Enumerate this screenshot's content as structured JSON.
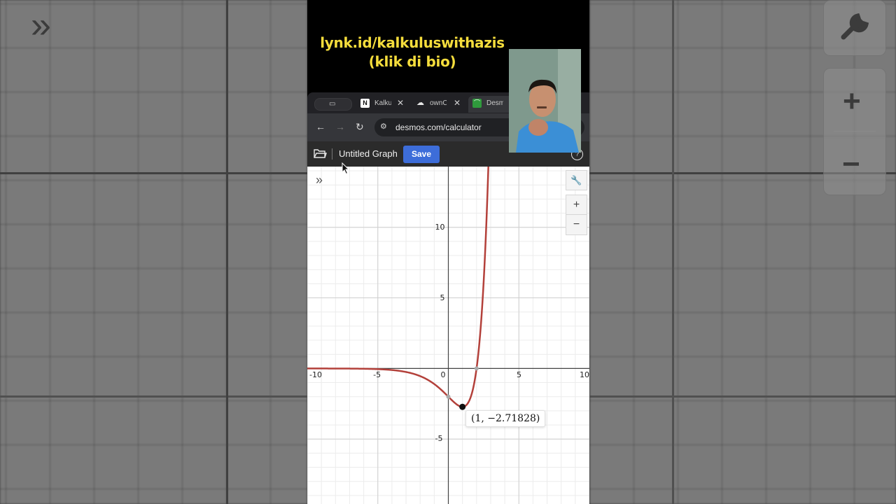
{
  "background": {
    "expand_glyph": "»",
    "wrench_glyph": "🔧",
    "plus_glyph": "+",
    "minus_glyph": "−"
  },
  "promo": {
    "line1": "lynk.id/kalkuluswithazis",
    "line2": "(klik di bio)",
    "color": "#f5dd3c"
  },
  "browser": {
    "tabs": [
      {
        "label": "Kalku",
        "favicon": "notion-icon",
        "active": false
      },
      {
        "label": "ownC",
        "favicon": "cloud-icon",
        "active": false
      },
      {
        "label": "Desm",
        "favicon": "desmos-icon",
        "active": true
      }
    ],
    "url": "desmos.com/calculator"
  },
  "desmos": {
    "title": "Untitled Graph",
    "save_label": "Save",
    "accent": "#3d6dd9",
    "curve_color": "#b3403a",
    "zoom_in": "+",
    "zoom_out": "−",
    "point_label": "(1, −2.71828)",
    "x_ticks": [
      "-10",
      "-5",
      "0",
      "5",
      "10"
    ],
    "y_ticks": [
      "10",
      "5",
      "-5"
    ]
  },
  "chart_data": {
    "type": "line",
    "function": "(x-2)·e^x",
    "xlim": [
      -10,
      10
    ],
    "ylim": [
      -9.6,
      14.3
    ],
    "grid": true,
    "x_tick_values": [
      -10,
      -5,
      0,
      5,
      10
    ],
    "y_tick_values": [
      10,
      5,
      -5
    ],
    "highlighted_point": {
      "x": 1,
      "y": -2.71828
    }
  }
}
